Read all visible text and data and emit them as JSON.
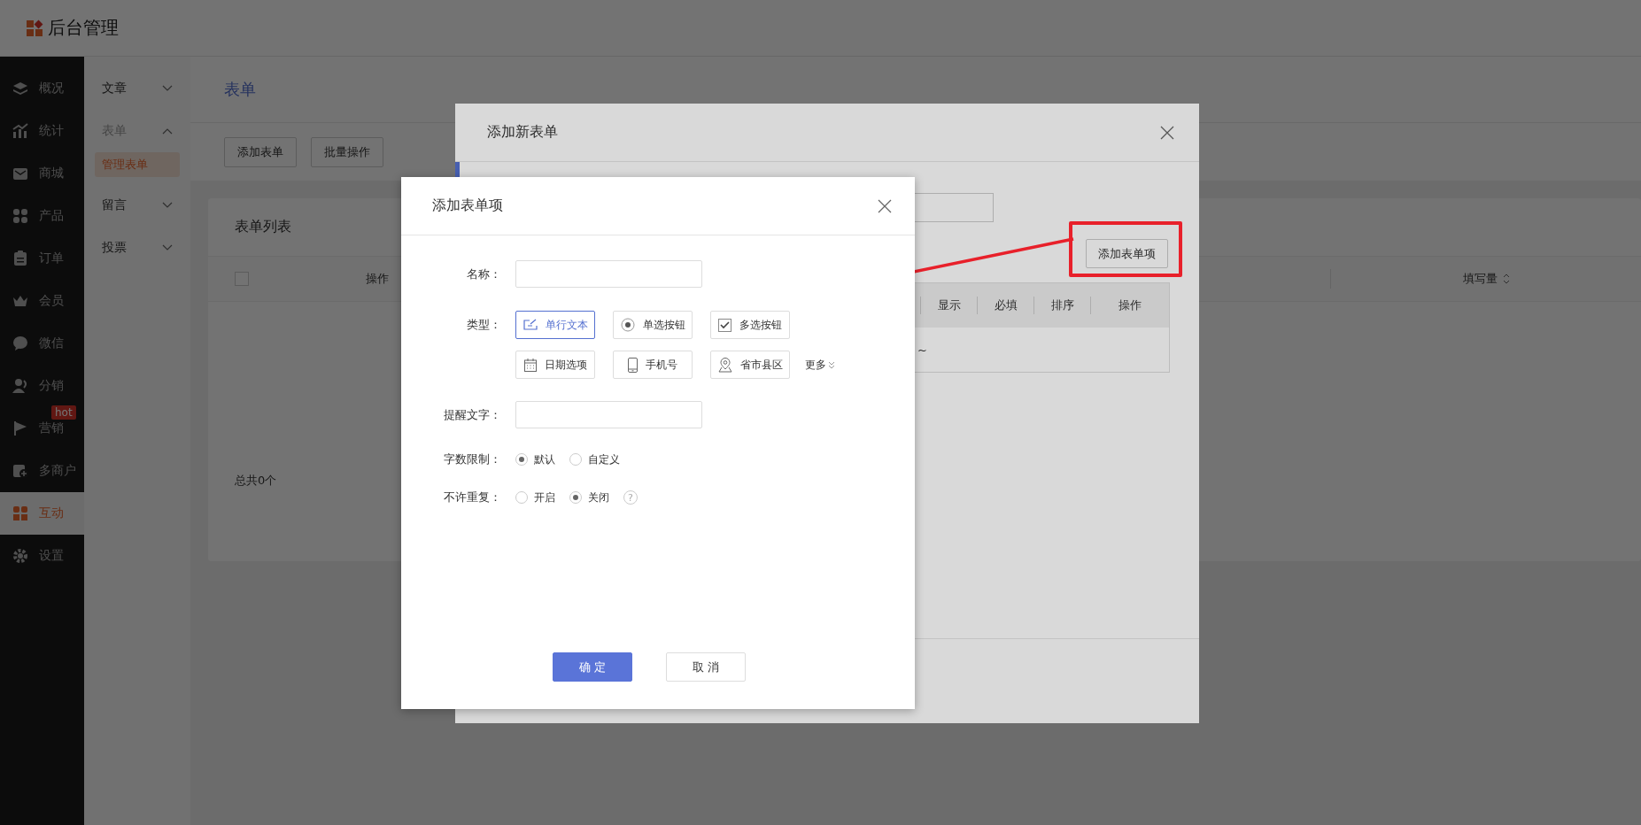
{
  "header": {
    "title": "后台管理"
  },
  "nav": [
    {
      "label": "概况",
      "selected": false
    },
    {
      "label": "统计",
      "selected": false
    },
    {
      "label": "商城",
      "selected": false
    },
    {
      "label": "产品",
      "selected": false
    },
    {
      "label": "订单",
      "selected": false
    },
    {
      "label": "会员",
      "selected": false
    },
    {
      "label": "微信",
      "selected": false
    },
    {
      "label": "分销",
      "selected": false
    },
    {
      "label": "营销",
      "selected": false,
      "badge": "hot"
    },
    {
      "label": "多商户",
      "selected": false
    },
    {
      "label": "互动",
      "selected": true
    },
    {
      "label": "设置",
      "selected": false
    }
  ],
  "subnav": [
    {
      "label": "文章",
      "expanded": false
    },
    {
      "label": "表单",
      "expanded": true,
      "children": [
        {
          "label": "管理表单",
          "selected": true
        }
      ]
    },
    {
      "label": "留言",
      "expanded": false
    },
    {
      "label": "投票",
      "expanded": false
    }
  ],
  "page": {
    "title": "表单",
    "actions": [
      "添加表单",
      "批量操作"
    ],
    "card": {
      "title": "表单列表",
      "select_all": {
        "checked": false
      },
      "columns": [
        {
          "label": "操作",
          "sortable": false
        },
        {
          "label": "填写量",
          "sortable": true
        }
      ],
      "footer": "总共0个"
    }
  },
  "form_dialog": {
    "title": "添加新表单",
    "add_item_button": "添加表单项",
    "columns": [
      "显示",
      "必填",
      "排序",
      "操作"
    ],
    "empty_text": "~"
  },
  "item_dialog": {
    "title": "添加表单项",
    "fields": [
      {
        "kind": "input",
        "label": "名称："
      },
      {
        "kind": "types",
        "label": "类型：",
        "more": "更多",
        "options": [
          {
            "label": "单行文本",
            "selected": true
          },
          {
            "label": "单选按钮",
            "selected": false
          },
          {
            "label": "多选按钮",
            "selected": false
          },
          {
            "label": "日期选项",
            "selected": false
          },
          {
            "label": "手机号",
            "selected": false
          },
          {
            "label": "省市县区",
            "selected": false
          }
        ]
      },
      {
        "kind": "input",
        "label": "提醒文字："
      },
      {
        "kind": "radio",
        "label": "字数限制：",
        "options": [
          {
            "label": "默认",
            "selected": true
          },
          {
            "label": "自定义",
            "selected": false
          }
        ]
      },
      {
        "kind": "radio",
        "label": "不许重复：",
        "help": "?",
        "options": [
          {
            "label": "开启",
            "selected": false
          },
          {
            "label": "关闭",
            "selected": true
          }
        ]
      }
    ],
    "buttons": [
      {
        "label": "确 定",
        "kind": "primary"
      },
      {
        "label": "取 消",
        "kind": "default"
      }
    ]
  }
}
